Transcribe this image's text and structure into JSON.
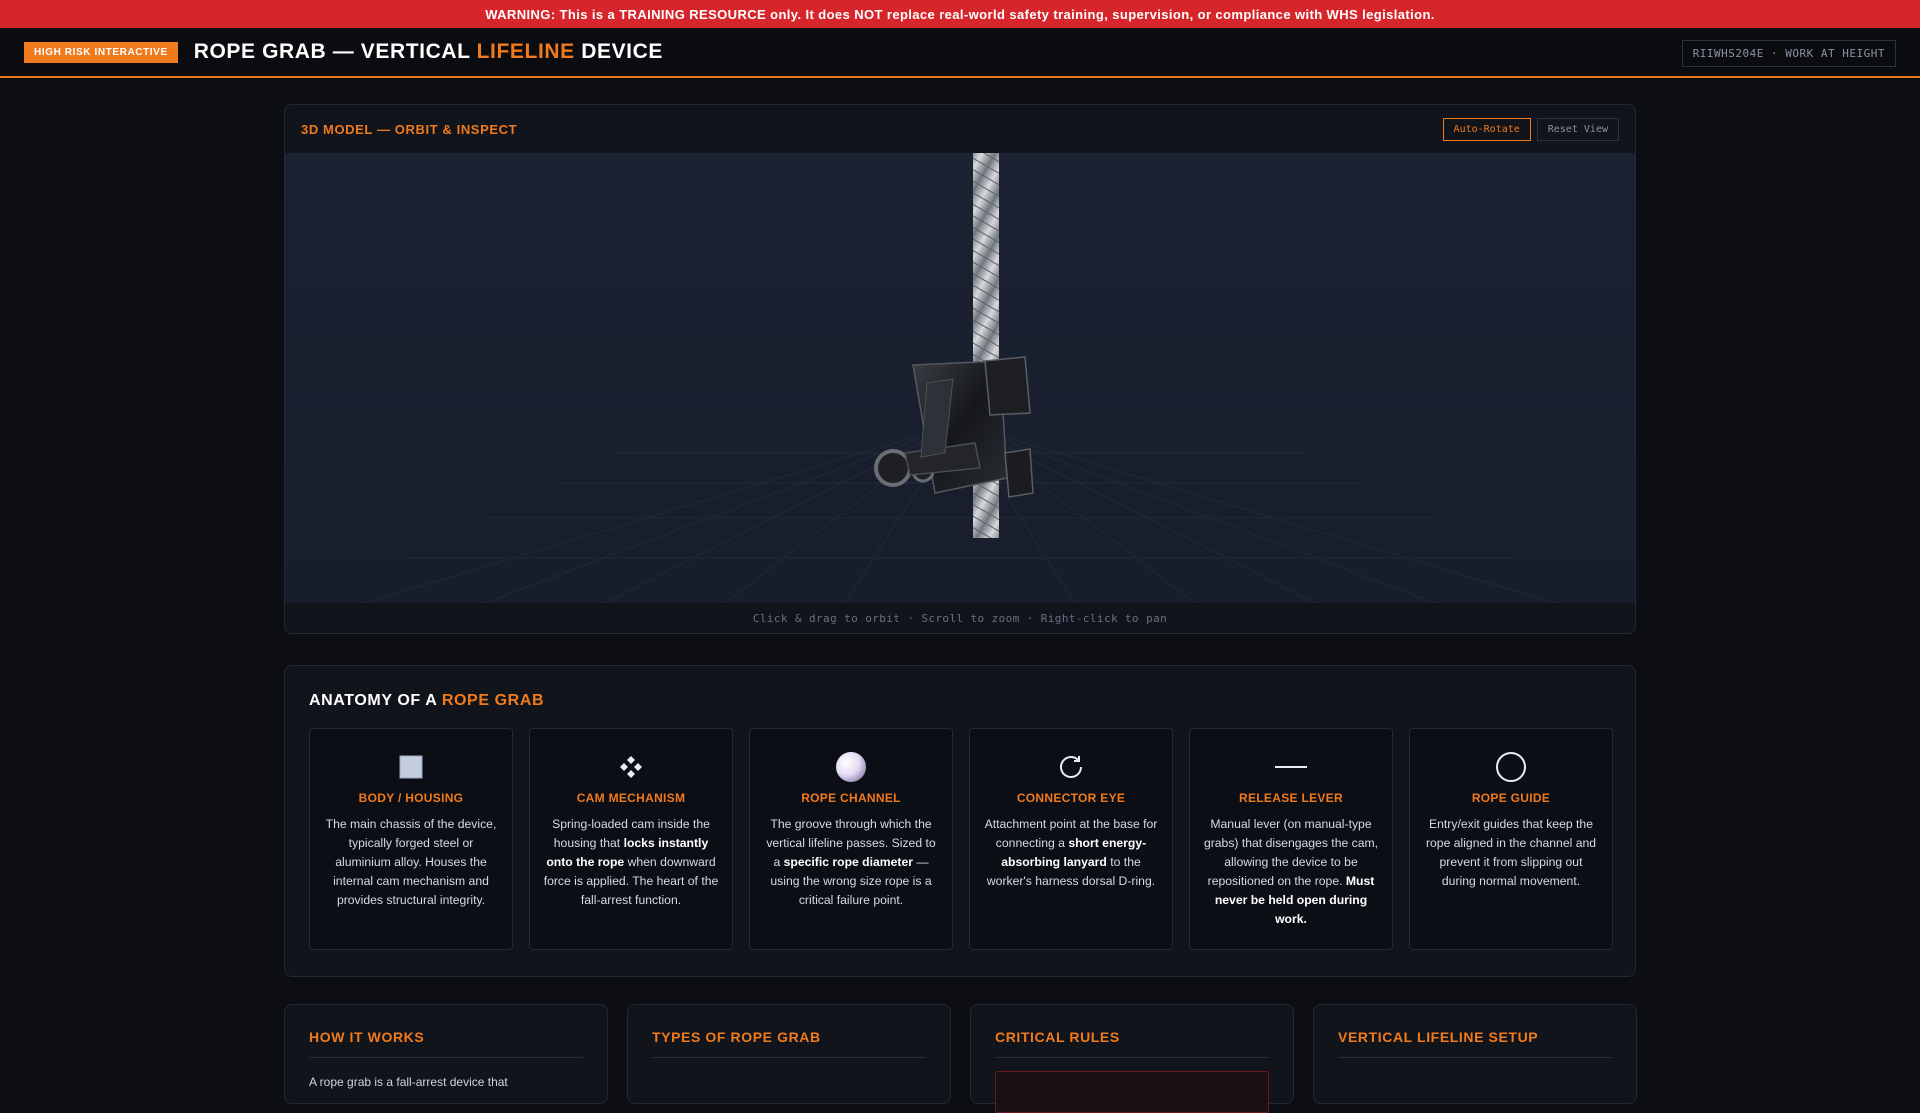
{
  "warning": "WARNING: This is a TRAINING RESOURCE only. It does NOT replace real-world safety training, supervision, or compliance with WHS legislation.",
  "header": {
    "badge": "HIGH RISK INTERACTIVE",
    "title_part1": "ROPE GRAB — VERTICAL ",
    "title_accent": "LIFELINE",
    "title_part2": " DEVICE",
    "code": "RIIWHS204E · WORK AT HEIGHT"
  },
  "viewer": {
    "title": "3D MODEL — ORBIT & INSPECT",
    "auto_rotate_label": "Auto-Rotate",
    "reset_view_label": "Reset View",
    "hint": "Click & drag to orbit · Scroll to zoom · Right-click to pan"
  },
  "anatomy": {
    "title_prefix": "ANATOMY OF A ",
    "title_accent": "ROPE GRAB",
    "cards": [
      {
        "icon": "square-icon",
        "title": "BODY / HOUSING",
        "desc": "The main chassis of the device, typically forged steel or aluminium alloy. Houses the internal cam mechanism and provides structural integrity."
      },
      {
        "icon": "diamond-cluster-icon",
        "title": "CAM MECHANISM",
        "desc": "Spring-loaded cam inside the housing that locks instantly onto the rope when downward force is applied. The heart of the fall-arrest function."
      },
      {
        "icon": "sphere-icon",
        "title": "ROPE CHANNEL",
        "desc": "The groove through which the vertical lifeline passes. Sized to a specific rope diameter — using the wrong size rope is a critical failure point."
      },
      {
        "icon": "rotate-icon",
        "title": "CONNECTOR EYE",
        "desc": "Attachment point at the base for connecting a short energy-absorbing lanyard to the worker's harness dorsal D-ring."
      },
      {
        "icon": "dash-icon",
        "title": "RELEASE LEVER",
        "desc": "Manual lever (on manual-type grabs) that disengages the cam, allowing the device to be repositioned on the rope. Must never be held open during work."
      },
      {
        "icon": "circle-icon",
        "title": "ROPE GUIDE",
        "desc": "Entry/exit guides that keep the rope aligned in the channel and prevent it from slipping out during normal movement."
      }
    ]
  },
  "bottom_sections": [
    {
      "title": "HOW IT WORKS",
      "fragment": "A rope grab is a fall-arrest device that"
    },
    {
      "title": "TYPES OF ROPE GRAB"
    },
    {
      "title": "CRITICAL RULES"
    },
    {
      "title": "VERTICAL LIFELINE SETUP"
    }
  ],
  "colors": {
    "accent": "#f07a1c",
    "warning": "#d6262b",
    "background": "#0c0e13"
  }
}
